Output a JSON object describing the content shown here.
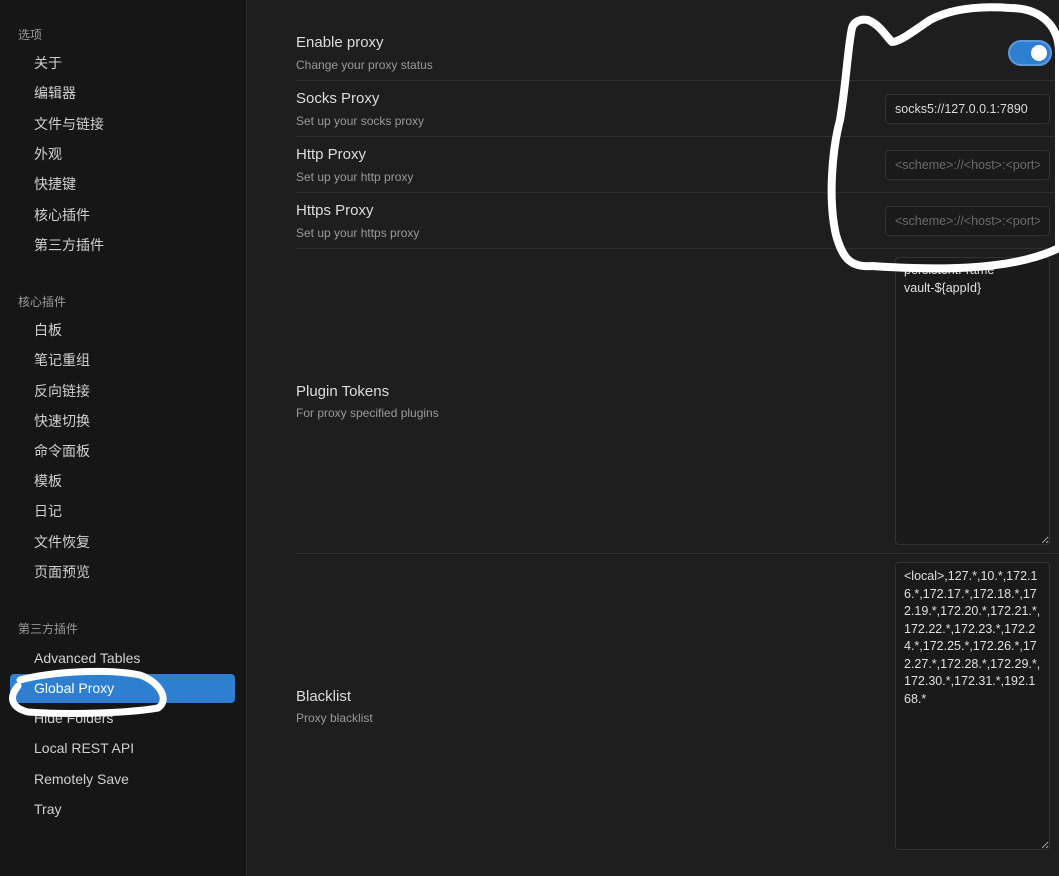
{
  "sidebar": {
    "sections": [
      {
        "title": "选项",
        "items": [
          "关于",
          "编辑器",
          "文件与链接",
          "外观",
          "快捷键",
          "核心插件",
          "第三方插件"
        ]
      },
      {
        "title": "核心插件",
        "items": [
          "白板",
          "笔记重组",
          "反向链接",
          "快速切换",
          "命令面板",
          "模板",
          "日记",
          "文件恢复",
          "页面预览"
        ]
      },
      {
        "title": "第三方插件",
        "items": [
          "Advanced Tables",
          "Global Proxy",
          "Hide Folders",
          "Local REST API",
          "Remotely Save",
          "Tray"
        ]
      }
    ],
    "active_item": "Global Proxy"
  },
  "settings": {
    "enable_proxy": {
      "name": "Enable proxy",
      "desc": "Change your proxy status",
      "enabled": true
    },
    "socks_proxy": {
      "name": "Socks Proxy",
      "desc": "Set up your socks proxy",
      "value": "socks5://127.0.0.1:7890",
      "placeholder": "<scheme>://<host>:<port>"
    },
    "http_proxy": {
      "name": "Http Proxy",
      "desc": "Set up your http proxy",
      "value": "",
      "placeholder": "<scheme>://<host>:<port>"
    },
    "https_proxy": {
      "name": "Https Proxy",
      "desc": "Set up your https proxy",
      "value": "",
      "placeholder": "<scheme>://<host>:<port>"
    },
    "plugin_tokens": {
      "name": "Plugin Tokens",
      "desc": "For proxy specified plugins",
      "value": "persistentFrame\nvault-${appId}"
    },
    "blacklist": {
      "name": "Blacklist",
      "desc": "Proxy blacklist",
      "value": "<local>,127.*,10.*,172.16.*,172.17.*,172.18.*,172.19.*,172.20.*,172.21.*,172.22.*,172.23.*,172.24.*,172.25.*,172.26.*,172.27.*,172.28.*,172.29.*,172.30.*,172.31.*,192.168.*"
    }
  },
  "colors": {
    "accent": "#2e7fd0",
    "background": "#1e1e1e",
    "sidebar_bg": "#161616"
  }
}
